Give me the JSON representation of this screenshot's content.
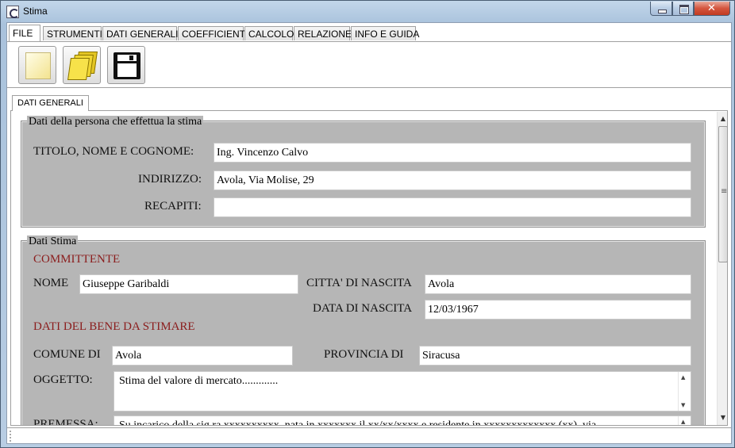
{
  "window": {
    "title": "Stima"
  },
  "menu_tabs": [
    "FILE",
    "STRUMENTI",
    "DATI GENERALI",
    "COEFFICIENTI",
    "CALCOLO",
    "RELAZIONE",
    "INFO E GUIDA"
  ],
  "toolbar": {
    "buttons": [
      "new-file-icon",
      "open-folder-icon",
      "save-icon"
    ]
  },
  "inner_tab": {
    "label": "DATI GENERALI"
  },
  "persona": {
    "legend": "Dati della persona che effettua la stima",
    "titolo_label": "TITOLO, NOME E COGNOME:",
    "titolo_value": "Ing. Vincenzo Calvo",
    "indirizzo_label": "INDIRIZZO:",
    "indirizzo_value": "Avola, Via Molise, 29",
    "recapiti_label": "RECAPITI:",
    "recapiti_value": ""
  },
  "stima": {
    "legend": "Dati Stima",
    "committente_heading": "COMMITTENTE",
    "nome_label": "NOME",
    "nome_value": "Giuseppe Garibaldi",
    "citta_label": "CITTA' DI NASCITA",
    "citta_value": "Avola",
    "data_label": "DATA DI NASCITA",
    "data_value": "12/03/1967",
    "bene_heading": "DATI DEL BENE DA STIMARE",
    "comune_label": "COMUNE DI",
    "comune_value": "Avola",
    "provincia_label": "PROVINCIA DI",
    "provincia_value": "Siracusa",
    "oggetto_label": "OGGETTO:",
    "oggetto_value": "Stima del valore di mercato.............",
    "premessa_label": "PREMESSA:",
    "premessa_value": "Su incarico della sig.ra xxxxxxxxxx, nata in xxxxxxx il xx/xx/xxxx e residente in xxxxxxxxxxxxx (xx), via"
  },
  "colors": {
    "section_heading": "#8b1d1d",
    "group_background": "#b6b6b6"
  }
}
